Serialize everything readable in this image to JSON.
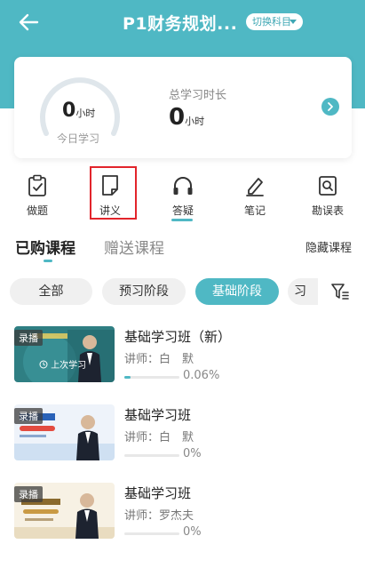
{
  "header": {
    "title": "P1财务规划...",
    "switch_label": "切换科目"
  },
  "stats": {
    "today_value": "0",
    "today_unit": "小时",
    "today_label": "今日学习",
    "total_label": "总学习时长",
    "total_value": "0",
    "total_unit": "小时"
  },
  "shortcuts": [
    {
      "label": "做题",
      "icon": "clipboard-icon"
    },
    {
      "label": "讲义",
      "icon": "document-icon"
    },
    {
      "label": "答疑",
      "icon": "headphones-icon"
    },
    {
      "label": "笔记",
      "icon": "pen-icon"
    },
    {
      "label": "勘误表",
      "icon": "search-document-icon"
    }
  ],
  "tabs": {
    "purchased": "已购课程",
    "gifted": "赠送课程",
    "hide": "隐藏课程"
  },
  "filters": [
    "全部",
    "预习阶段",
    "基础阶段",
    "习题"
  ],
  "active_filter": "基础阶段",
  "courses": [
    {
      "badge": "录播",
      "overlay": "上次学习",
      "title": "基础学习班（新）",
      "teacher": "讲师：白　默",
      "percent": "0.06%",
      "progress": 0.06
    },
    {
      "badge": "录播",
      "title": "基础学习班",
      "teacher": "讲师：白　默",
      "percent": "0%",
      "progress": 0
    },
    {
      "badge": "录播",
      "title": "基础学习班",
      "teacher": "讲师：罗杰夫",
      "percent": "0%",
      "progress": 0
    }
  ],
  "colors": {
    "accent": "#4fb8c4",
    "highlight": "#e2242b"
  }
}
